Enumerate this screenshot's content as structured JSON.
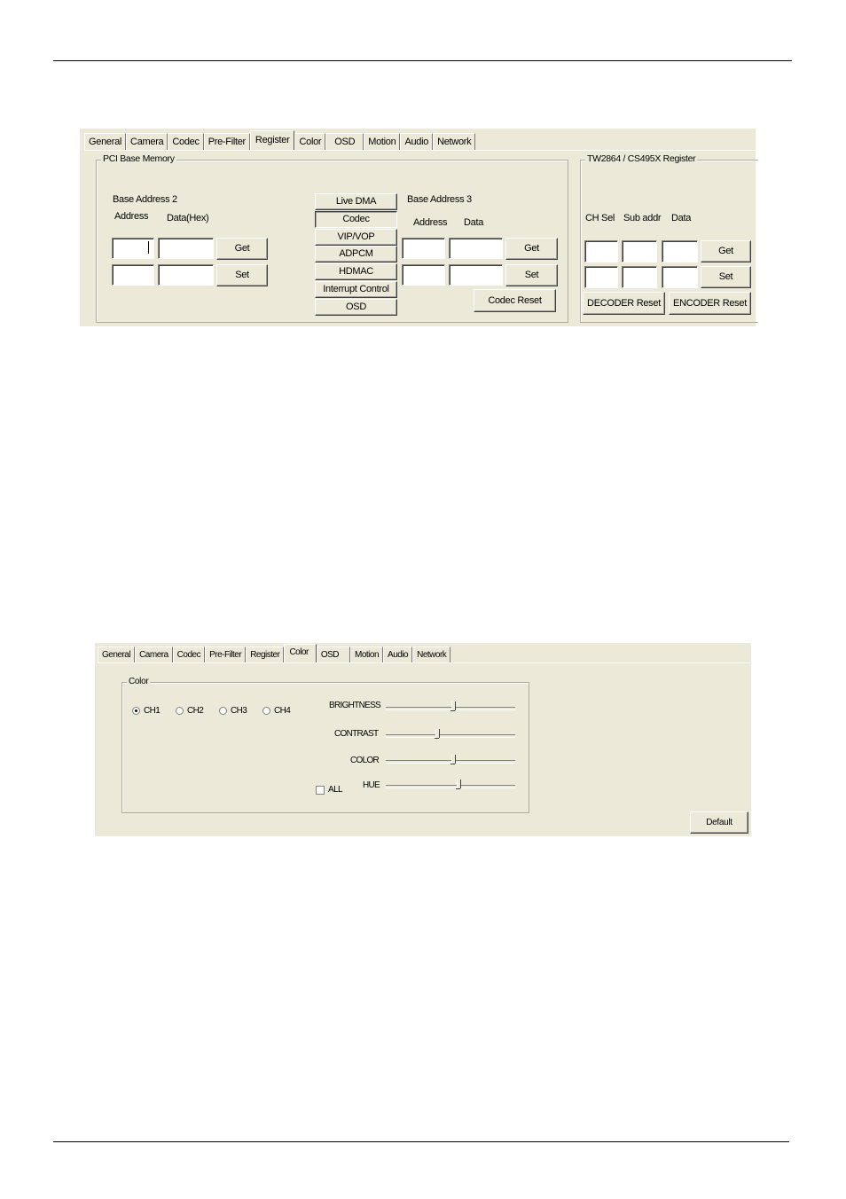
{
  "top_panel": {
    "tabs": [
      "General",
      "Camera",
      "Codec",
      "Pre-Filter",
      "Register",
      "Color",
      "OSD",
      "Motion",
      "Audio",
      "Network"
    ],
    "active_tab": "Register",
    "pci": {
      "legend": "PCI Base Memory",
      "base2_title": "Base Address 2",
      "address_label": "Address",
      "data_label": "Data(Hex)",
      "get": "Get",
      "set": "Set",
      "mid_buttons": [
        "Live DMA",
        "Codec",
        "VIP/VOP",
        "ADPCM",
        "HDMAC",
        "Interrupt Control",
        "OSD"
      ],
      "selected_mid_button": "Codec",
      "base3_title": "Base Address 3",
      "address3_label": "Address",
      "data3_label": "Data",
      "get3": "Get",
      "set3": "Set",
      "codec_reset": "Codec Reset"
    },
    "tw": {
      "legend": "TW2864 / CS495X Register",
      "ch_sel": "CH Sel",
      "sub_addr": "Sub addr",
      "data": "Data",
      "get": "Get",
      "set": "Set",
      "decoder_reset": "DECODER Reset",
      "encoder_reset": "ENCODER Reset"
    }
  },
  "bottom_panel": {
    "tabs": [
      "General",
      "Camera",
      "Codec",
      "Pre-Filter",
      "Register",
      "Color",
      "OSD",
      "Motion",
      "Audio",
      "Network"
    ],
    "active_tab": "Color",
    "color_group": {
      "legend": "Color",
      "channels": [
        "CH1",
        "CH2",
        "CH3",
        "CH4"
      ],
      "selected_channel": "CH1",
      "all_label": "ALL",
      "all_checked": false,
      "sliders": [
        {
          "label": "BRIGHTNESS",
          "value": 0.52
        },
        {
          "label": "CONTRAST",
          "value": 0.4
        },
        {
          "label": "COLOR",
          "value": 0.52
        },
        {
          "label": "HUE",
          "value": 0.56
        }
      ]
    },
    "default_button": "Default"
  }
}
